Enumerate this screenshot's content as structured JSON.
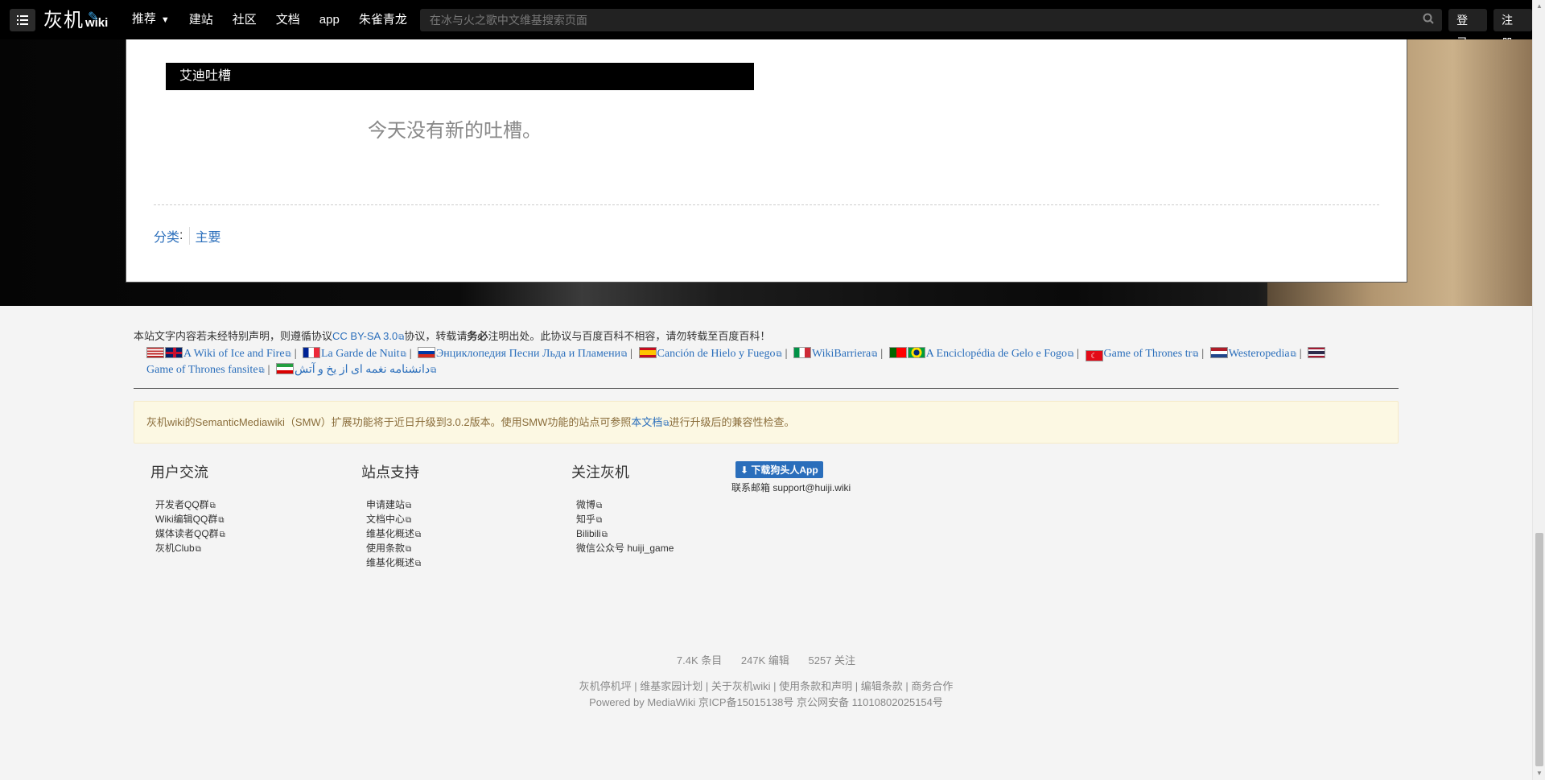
{
  "nav": {
    "logo_cn": "灰机",
    "logo_wiki": "wiki",
    "items": [
      {
        "label": "推荐",
        "has_caret": true
      },
      {
        "label": "建站"
      },
      {
        "label": "社区"
      },
      {
        "label": "文档"
      },
      {
        "label": "app"
      },
      {
        "label": "朱雀青龙"
      }
    ],
    "search_placeholder": "在冰与火之歌中文维基搜索页面",
    "login": "登录",
    "register": "注册"
  },
  "content": {
    "tucao_title": "艾迪吐槽",
    "no_tucao": "今天没有新的吐槽。",
    "categories_label": "分类",
    "categories_colon": ":",
    "categories": [
      "主要"
    ]
  },
  "footer": {
    "license_pre": "本站文字内容若未经特别声明，则遵循协议",
    "license_link": "CC BY-SA 3.0",
    "license_mid": "协议，转载请",
    "license_bold": "务必",
    "license_post": "注明出处。此协议与百度百科不相容，请勿转载至百度百科！",
    "ext_sites": [
      {
        "name": "A Wiki of Ice and Fire"
      },
      {
        "name": "La Garde de Nuit"
      },
      {
        "name": "Энциклопедия Песни Льда и Пламени"
      },
      {
        "name": "Canción de Hielo y Fuego"
      },
      {
        "name": "WikiBarriera"
      },
      {
        "name": "A Enciclopédia de Gelo e Fogo"
      },
      {
        "name": "Game of Thrones tr"
      },
      {
        "name": "Westeropedia"
      },
      {
        "name": "Game of Thrones fansite"
      },
      {
        "name": "دانشنامه نغمه ای از یخ و آتش"
      }
    ],
    "notice_pre": "灰机wiki的SemanticMediawiki（SMW）扩展功能将于近日升级到3.0.2版本。使用SMW功能的站点可参照",
    "notice_link": "本文档",
    "notice_post": "进行升级后的兼容性检查。",
    "columns": [
      {
        "title": "用户交流",
        "items": [
          "开发者QQ群",
          "Wiki编辑QQ群",
          "媒体读者QQ群",
          "灰机Club"
        ]
      },
      {
        "title": "站点支持",
        "items": [
          "申请建站",
          "文档中心",
          "维基化概述",
          "使用条款",
          "维基化概述"
        ]
      },
      {
        "title": "关注灰机",
        "items": [
          "微博",
          "知乎",
          "Bilibili"
        ],
        "extra": "微信公众号 huiji_game"
      }
    ],
    "app_button": "下载狗头人App",
    "contact": "联系邮箱 support@huiji.wiki",
    "stats": [
      "7.4K 条目",
      "247K 编辑",
      "5257 关注"
    ],
    "bottom_links": [
      "灰机停机坪",
      "维基家园计划",
      "关于灰机wiki",
      "使用条款和声明",
      "编辑条款",
      "商务合作"
    ],
    "powered": "Powered by MediaWiki 京ICP备15015138号 京公网安备 11010802025154号"
  }
}
